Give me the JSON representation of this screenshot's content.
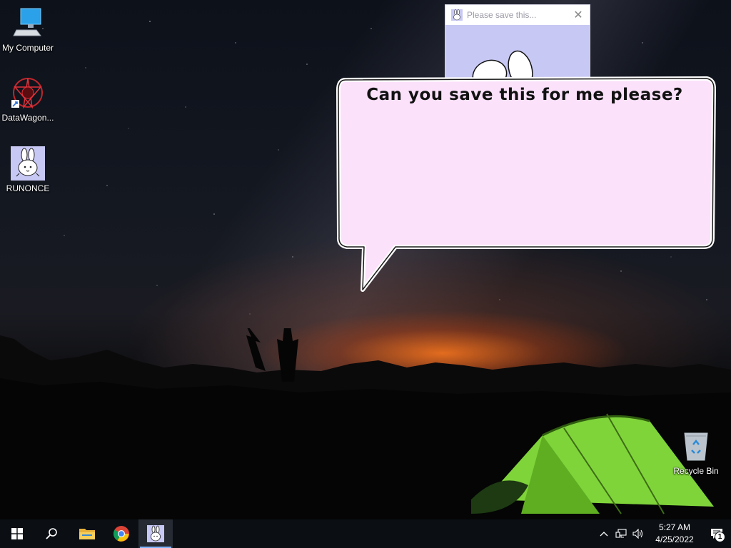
{
  "desktop": {
    "icons": [
      {
        "label": "My Computer",
        "icon": "computer-icon"
      },
      {
        "label": "DataWagon...",
        "icon": "datawagon-icon"
      },
      {
        "label": "RUNONCE",
        "icon": "bunny-icon"
      },
      {
        "label": "Recycle Bin",
        "icon": "recycle-bin-icon"
      }
    ]
  },
  "popup": {
    "title": "Please save this...",
    "close_glyph": "✕"
  },
  "bubble": {
    "text": "Can you save this for me please?"
  },
  "taskbar": {
    "time": "5:27 AM",
    "date": "4/25/2022",
    "notification_count": "1",
    "tray_chevron": "^",
    "accent": "#7fb4ff"
  }
}
